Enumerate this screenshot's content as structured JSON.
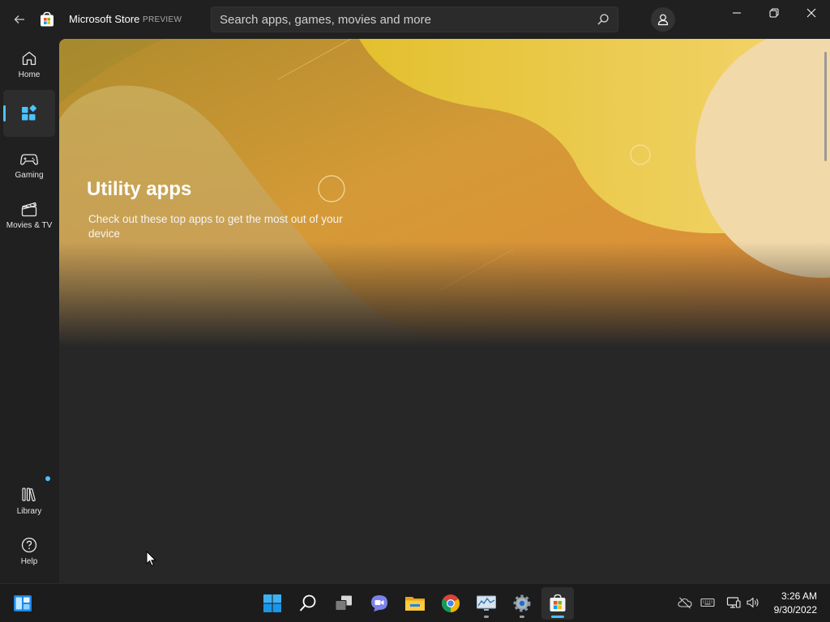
{
  "app": {
    "title": "Microsoft Store",
    "badge": "PREVIEW"
  },
  "search": {
    "placeholder": "Search apps, games, movies and more"
  },
  "sidebar": {
    "items": [
      {
        "label": "Home",
        "icon": "home-icon"
      },
      {
        "label": "",
        "icon": "apps-icon",
        "active": true
      },
      {
        "label": "Gaming",
        "icon": "gamepad-icon"
      },
      {
        "label": "Movies & TV",
        "icon": "clapperboard-icon"
      },
      {
        "label": "Library",
        "icon": "library-icon",
        "notification": true
      },
      {
        "label": "Help",
        "icon": "help-icon"
      }
    ]
  },
  "hero": {
    "title": "Utility apps",
    "subtitle": "Check out these top apps to get the most out of your device"
  },
  "taskbar": {
    "apps": [
      "widgets-icon",
      "start-icon",
      "search-icon",
      "task-view-icon",
      "teams-chat-icon",
      "file-explorer-icon",
      "chrome-icon",
      "monitor-icon",
      "settings-icon",
      "microsoft-store-icon"
    ],
    "tray": [
      "onedrive-off-icon",
      "keyboard-icon",
      "network-icon",
      "volume-icon"
    ],
    "time": "3:26 AM",
    "date": "9/30/2022"
  },
  "colors": {
    "accent": "#4cc2ff",
    "background": "#202020",
    "content": "#272727"
  }
}
